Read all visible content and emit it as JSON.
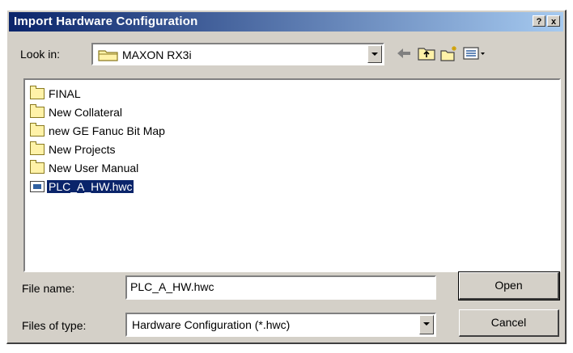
{
  "dialog": {
    "title": "Import Hardware Configuration",
    "help_button": "?",
    "close_button": "x"
  },
  "lookin": {
    "label": "Look in:",
    "folder": "MAXON RX3i"
  },
  "toolbar": {
    "icons": [
      "back-arrow-icon",
      "up-folder-icon",
      "new-folder-icon",
      "view-menu-icon"
    ]
  },
  "files": [
    {
      "name": "FINAL",
      "type": "folder"
    },
    {
      "name": "New Collateral",
      "type": "folder"
    },
    {
      "name": "new GE Fanuc Bit Map",
      "type": "folder"
    },
    {
      "name": "New Projects",
      "type": "folder"
    },
    {
      "name": "New User Manual",
      "type": "folder"
    },
    {
      "name": "PLC_A_HW.hwc",
      "type": "file",
      "selected": true
    }
  ],
  "filename": {
    "label": "File name:",
    "value": "PLC_A_HW.hwc"
  },
  "filetype": {
    "label": "Files of type:",
    "value": "Hardware Configuration (*.hwc)"
  },
  "buttons": {
    "open": "Open",
    "cancel": "Cancel"
  }
}
